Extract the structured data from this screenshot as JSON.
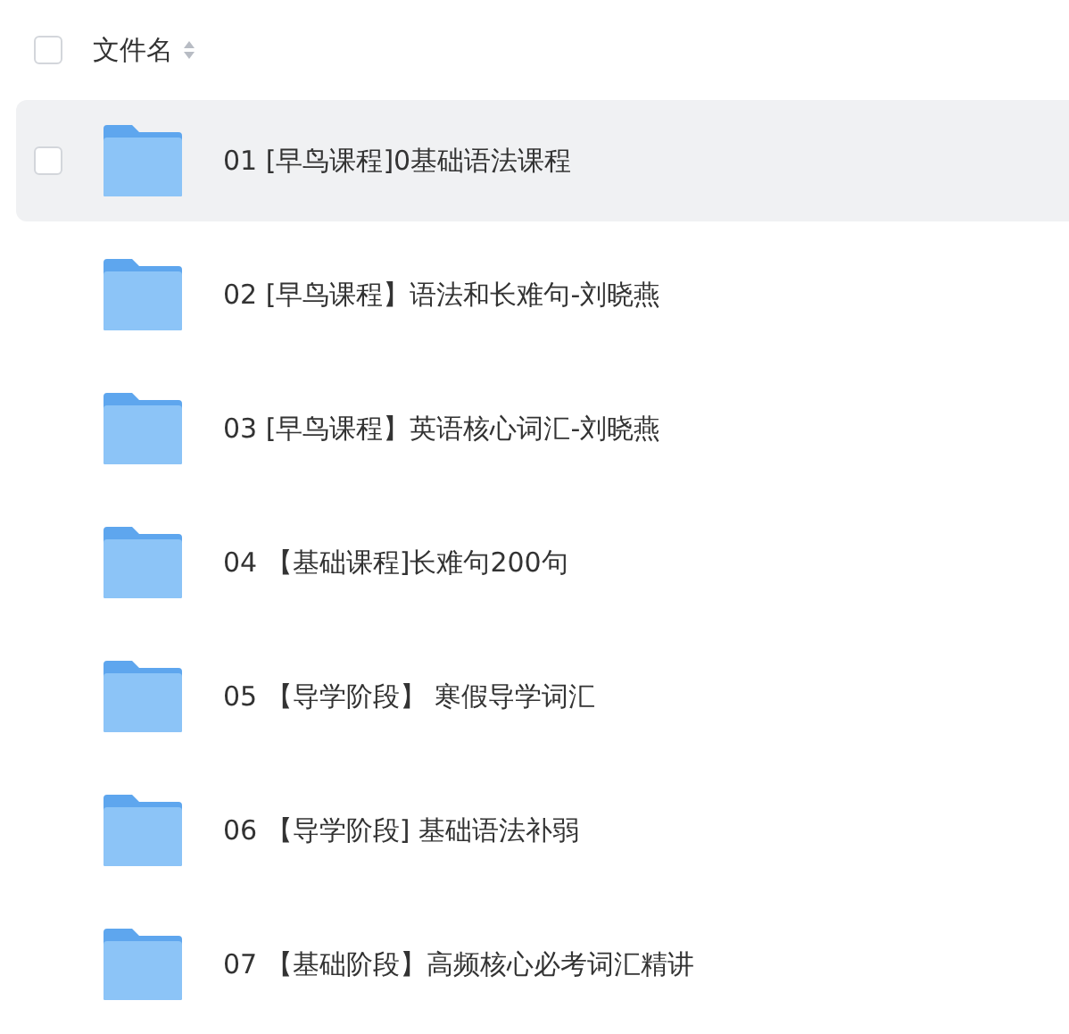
{
  "header": {
    "checked": false,
    "label": "文件名"
  },
  "files": [
    {
      "name": "01 [早鸟课程]0基础语法课程",
      "highlighted": true
    },
    {
      "name": "02 [早鸟课程】语法和长难句-刘晓燕",
      "highlighted": false
    },
    {
      "name": "03 [早鸟课程】英语核心词汇-刘晓燕",
      "highlighted": false
    },
    {
      "name": "04 【基础课程]长难句200句",
      "highlighted": false
    },
    {
      "name": "05 【导学阶段】 寒假导学词汇",
      "highlighted": false
    },
    {
      "name": "06 【导学阶段] 基础语法补弱",
      "highlighted": false
    },
    {
      "name": "07 【基础阶段】高频核心必考词汇精讲",
      "highlighted": false
    }
  ]
}
